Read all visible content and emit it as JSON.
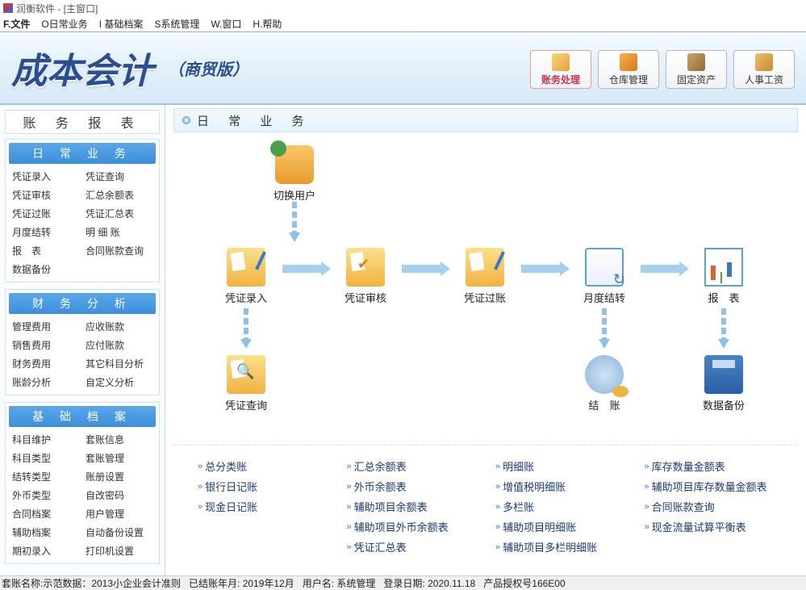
{
  "window": {
    "title": "润衡软件 - [主窗口]"
  },
  "menu": [
    "F.文件",
    "O日常业务",
    "I 基础档案",
    "S系统管理",
    "W.窗口",
    "H.帮助"
  ],
  "banner": {
    "title": "成本会计",
    "sub": "（商贸版）"
  },
  "modules": [
    {
      "label": "账务处理",
      "active": true
    },
    {
      "label": "仓库管理",
      "active": false
    },
    {
      "label": "固定资产",
      "active": false
    },
    {
      "label": "人事工资",
      "active": false
    }
  ],
  "sidebar": {
    "title": "账 务 报 表",
    "groups": [
      {
        "head": "日 常 业 务",
        "items": [
          "凭证录入",
          "凭证查询",
          "凭证审核",
          "汇总余额表",
          "凭证过账",
          "凭证汇总表",
          "月度结转",
          "明 细 账",
          "报　表",
          "合同账款查询",
          "数据备份"
        ]
      },
      {
        "head": "财 务 分 析",
        "items": [
          "管理费用",
          "应收账款",
          "销售费用",
          "应付账款",
          "财务费用",
          "其它科目分析",
          "账龄分析",
          "自定义分析"
        ]
      },
      {
        "head": "基 础 档 案",
        "items": [
          "科目维护",
          "套账信息",
          "科目类型",
          "套账管理",
          "结转类型",
          "账册设置",
          "外币类型",
          "自改密码",
          "合同档案",
          "用户管理",
          "辅助档案",
          "自动备份设置",
          "期初录入",
          "打印机设置"
        ]
      }
    ]
  },
  "content": {
    "head": "日 常 业 务",
    "flow": {
      "switch_user": "切换用户",
      "entry": "凭证录入",
      "audit": "凭证审核",
      "post": "凭证过账",
      "month": "月度结转",
      "report": "报　表",
      "query": "凭证查询",
      "close": "结　账",
      "backup": "数据备份"
    },
    "links": [
      [
        "总分类账",
        "汇总余额表",
        "明细账",
        "库存数量金额表"
      ],
      [
        "银行日记账",
        "外币余额表",
        "增值税明细账",
        "辅助项目库存数量金额表"
      ],
      [
        "现金日记账",
        "辅助项目余额表",
        "多栏账",
        "合同账款查询"
      ],
      [
        "",
        "辅助项目外币余额表",
        "辅助项目明细账",
        "现金流量试算平衡表"
      ],
      [
        "",
        "凭证汇总表",
        "辅助项目多栏明细账",
        ""
      ]
    ]
  },
  "status": {
    "acct": "套账名称:示范数据：2013小企业会计准则",
    "period": "已结账年月: 2019年12月",
    "user": "用户名: 系统管理",
    "login": "登录日期: 2020.11.18",
    "lic": "产品授权号166E00"
  }
}
